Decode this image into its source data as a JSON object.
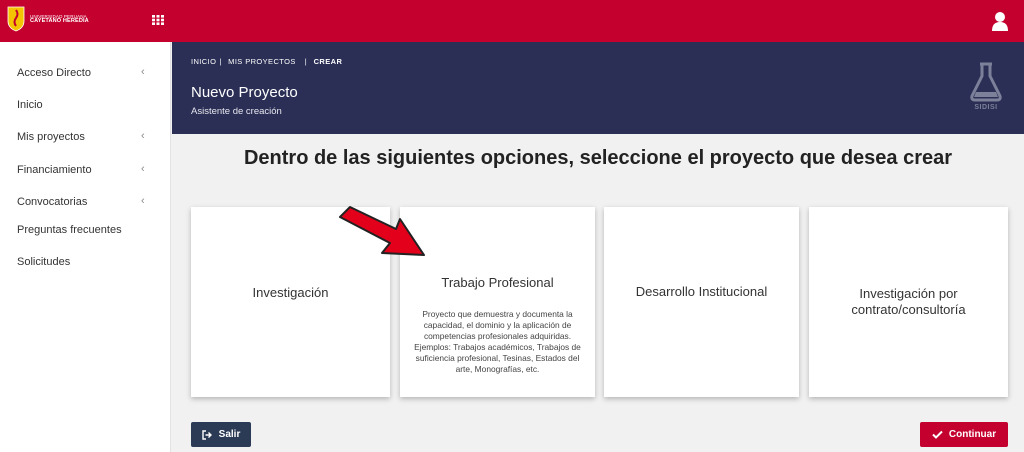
{
  "topbar": {
    "logo_line1": "UNIVERSIDAD PERUANA",
    "logo_line2": "CAYETANO HEREDIA",
    "brand_color": "#c4002f",
    "apps_icon": "grid-icon",
    "user_icon": "user-icon"
  },
  "sidebar": {
    "items": [
      {
        "label": "Acceso Directo",
        "chevron": "‹"
      },
      {
        "label": "Inicio",
        "chevron": ""
      },
      {
        "label": "Mis proyectos",
        "chevron": "‹"
      },
      {
        "label": "Financiamiento",
        "chevron": "‹"
      },
      {
        "label": "Convocatorias",
        "chevron": "‹"
      },
      {
        "label": "Preguntas frecuentes",
        "chevron": ""
      },
      {
        "label": "Solicitudes",
        "chevron": ""
      }
    ]
  },
  "header": {
    "breadcrumb": [
      "INICIO",
      "MIS PROYECTOS",
      "CREAR"
    ],
    "title": "Nuevo Proyecto",
    "subtitle": "Asistente de creación",
    "badge": "SIDISI",
    "band_color": "#2b2f55"
  },
  "main": {
    "heading": "Dentro de las siguientes opciones, seleccione el proyecto que desea crear",
    "cards": [
      {
        "title": "Investigación",
        "description": ""
      },
      {
        "title": "Trabajo Profesional",
        "description": "Proyecto que demuestra y documenta la capacidad, el dominio y la aplicación de competencias profesionales adquiridas. Ejemplos: Trabajos académicos, Trabajos de suficiencia profesional, Tesinas, Estados del arte, Monografías, etc."
      },
      {
        "title": "Desarrollo Institucional",
        "description": ""
      },
      {
        "title": "Investigación por contrato/consultoría",
        "description": ""
      }
    ],
    "annotation_color": "#e3001b"
  },
  "actions": {
    "exit_label": "Salir",
    "continue_label": "Continuar"
  }
}
